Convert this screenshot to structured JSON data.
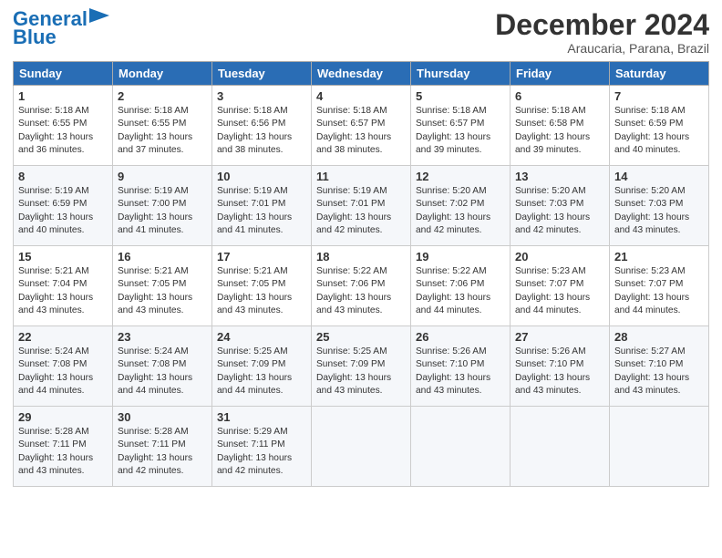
{
  "header": {
    "logo_general": "General",
    "logo_blue": "Blue",
    "month": "December 2024",
    "location": "Araucaria, Parana, Brazil"
  },
  "weekdays": [
    "Sunday",
    "Monday",
    "Tuesday",
    "Wednesday",
    "Thursday",
    "Friday",
    "Saturday"
  ],
  "weeks": [
    [
      {
        "day": "1",
        "lines": [
          "Sunrise: 5:18 AM",
          "Sunset: 6:55 PM",
          "Daylight: 13 hours",
          "and 36 minutes."
        ]
      },
      {
        "day": "2",
        "lines": [
          "Sunrise: 5:18 AM",
          "Sunset: 6:55 PM",
          "Daylight: 13 hours",
          "and 37 minutes."
        ]
      },
      {
        "day": "3",
        "lines": [
          "Sunrise: 5:18 AM",
          "Sunset: 6:56 PM",
          "Daylight: 13 hours",
          "and 38 minutes."
        ]
      },
      {
        "day": "4",
        "lines": [
          "Sunrise: 5:18 AM",
          "Sunset: 6:57 PM",
          "Daylight: 13 hours",
          "and 38 minutes."
        ]
      },
      {
        "day": "5",
        "lines": [
          "Sunrise: 5:18 AM",
          "Sunset: 6:57 PM",
          "Daylight: 13 hours",
          "and 39 minutes."
        ]
      },
      {
        "day": "6",
        "lines": [
          "Sunrise: 5:18 AM",
          "Sunset: 6:58 PM",
          "Daylight: 13 hours",
          "and 39 minutes."
        ]
      },
      {
        "day": "7",
        "lines": [
          "Sunrise: 5:18 AM",
          "Sunset: 6:59 PM",
          "Daylight: 13 hours",
          "and 40 minutes."
        ]
      }
    ],
    [
      {
        "day": "8",
        "lines": [
          "Sunrise: 5:19 AM",
          "Sunset: 6:59 PM",
          "Daylight: 13 hours",
          "and 40 minutes."
        ]
      },
      {
        "day": "9",
        "lines": [
          "Sunrise: 5:19 AM",
          "Sunset: 7:00 PM",
          "Daylight: 13 hours",
          "and 41 minutes."
        ]
      },
      {
        "day": "10",
        "lines": [
          "Sunrise: 5:19 AM",
          "Sunset: 7:01 PM",
          "Daylight: 13 hours",
          "and 41 minutes."
        ]
      },
      {
        "day": "11",
        "lines": [
          "Sunrise: 5:19 AM",
          "Sunset: 7:01 PM",
          "Daylight: 13 hours",
          "and 42 minutes."
        ]
      },
      {
        "day": "12",
        "lines": [
          "Sunrise: 5:20 AM",
          "Sunset: 7:02 PM",
          "Daylight: 13 hours",
          "and 42 minutes."
        ]
      },
      {
        "day": "13",
        "lines": [
          "Sunrise: 5:20 AM",
          "Sunset: 7:03 PM",
          "Daylight: 13 hours",
          "and 42 minutes."
        ]
      },
      {
        "day": "14",
        "lines": [
          "Sunrise: 5:20 AM",
          "Sunset: 7:03 PM",
          "Daylight: 13 hours",
          "and 43 minutes."
        ]
      }
    ],
    [
      {
        "day": "15",
        "lines": [
          "Sunrise: 5:21 AM",
          "Sunset: 7:04 PM",
          "Daylight: 13 hours",
          "and 43 minutes."
        ]
      },
      {
        "day": "16",
        "lines": [
          "Sunrise: 5:21 AM",
          "Sunset: 7:05 PM",
          "Daylight: 13 hours",
          "and 43 minutes."
        ]
      },
      {
        "day": "17",
        "lines": [
          "Sunrise: 5:21 AM",
          "Sunset: 7:05 PM",
          "Daylight: 13 hours",
          "and 43 minutes."
        ]
      },
      {
        "day": "18",
        "lines": [
          "Sunrise: 5:22 AM",
          "Sunset: 7:06 PM",
          "Daylight: 13 hours",
          "and 43 minutes."
        ]
      },
      {
        "day": "19",
        "lines": [
          "Sunrise: 5:22 AM",
          "Sunset: 7:06 PM",
          "Daylight: 13 hours",
          "and 44 minutes."
        ]
      },
      {
        "day": "20",
        "lines": [
          "Sunrise: 5:23 AM",
          "Sunset: 7:07 PM",
          "Daylight: 13 hours",
          "and 44 minutes."
        ]
      },
      {
        "day": "21",
        "lines": [
          "Sunrise: 5:23 AM",
          "Sunset: 7:07 PM",
          "Daylight: 13 hours",
          "and 44 minutes."
        ]
      }
    ],
    [
      {
        "day": "22",
        "lines": [
          "Sunrise: 5:24 AM",
          "Sunset: 7:08 PM",
          "Daylight: 13 hours",
          "and 44 minutes."
        ]
      },
      {
        "day": "23",
        "lines": [
          "Sunrise: 5:24 AM",
          "Sunset: 7:08 PM",
          "Daylight: 13 hours",
          "and 44 minutes."
        ]
      },
      {
        "day": "24",
        "lines": [
          "Sunrise: 5:25 AM",
          "Sunset: 7:09 PM",
          "Daylight: 13 hours",
          "and 44 minutes."
        ]
      },
      {
        "day": "25",
        "lines": [
          "Sunrise: 5:25 AM",
          "Sunset: 7:09 PM",
          "Daylight: 13 hours",
          "and 43 minutes."
        ]
      },
      {
        "day": "26",
        "lines": [
          "Sunrise: 5:26 AM",
          "Sunset: 7:10 PM",
          "Daylight: 13 hours",
          "and 43 minutes."
        ]
      },
      {
        "day": "27",
        "lines": [
          "Sunrise: 5:26 AM",
          "Sunset: 7:10 PM",
          "Daylight: 13 hours",
          "and 43 minutes."
        ]
      },
      {
        "day": "28",
        "lines": [
          "Sunrise: 5:27 AM",
          "Sunset: 7:10 PM",
          "Daylight: 13 hours",
          "and 43 minutes."
        ]
      }
    ],
    [
      {
        "day": "29",
        "lines": [
          "Sunrise: 5:28 AM",
          "Sunset: 7:11 PM",
          "Daylight: 13 hours",
          "and 43 minutes."
        ]
      },
      {
        "day": "30",
        "lines": [
          "Sunrise: 5:28 AM",
          "Sunset: 7:11 PM",
          "Daylight: 13 hours",
          "and 42 minutes."
        ]
      },
      {
        "day": "31",
        "lines": [
          "Sunrise: 5:29 AM",
          "Sunset: 7:11 PM",
          "Daylight: 13 hours",
          "and 42 minutes."
        ]
      },
      null,
      null,
      null,
      null
    ]
  ]
}
